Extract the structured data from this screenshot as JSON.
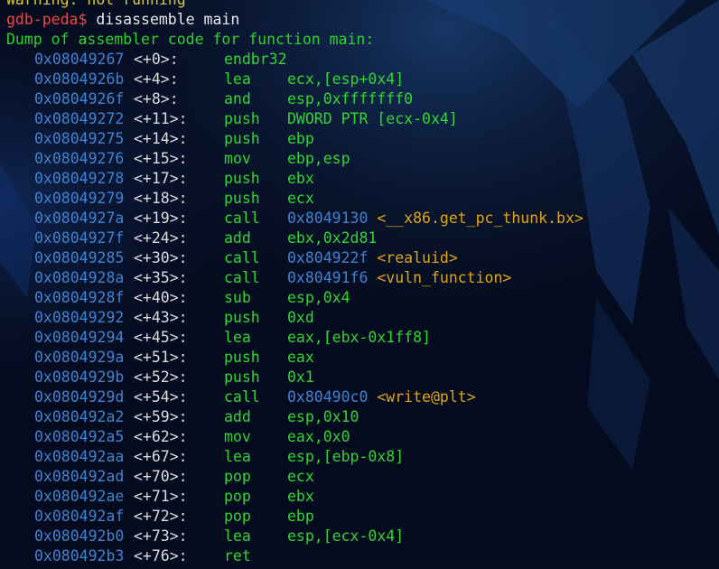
{
  "colors": {
    "background": "#050b1e",
    "warning": "#d7c93a",
    "prompt": "#e84a4a",
    "header": "#2dd32d",
    "address": "#3f84d4",
    "offset": "#dcdcdc",
    "instruction": "#2fd82f",
    "symbol": "#e0a512"
  },
  "warning": "Warning: not running",
  "prompt": "gdb-peda$",
  "command": " disassemble main",
  "header": "Dump of assembler code for function main:",
  "instructions": [
    {
      "address": "0x08049267",
      "offset": "<+0>:",
      "mnemonic": "endbr32",
      "operand": "",
      "symbol": ""
    },
    {
      "address": "0x0804926b",
      "offset": "<+4>:",
      "mnemonic": "lea",
      "operand": "ecx,[esp+0x4]",
      "symbol": ""
    },
    {
      "address": "0x0804926f",
      "offset": "<+8>:",
      "mnemonic": "and",
      "operand": "esp,0xfffffff0",
      "symbol": ""
    },
    {
      "address": "0x08049272",
      "offset": "<+11>:",
      "mnemonic": "push",
      "operand": "DWORD PTR [ecx-0x4]",
      "symbol": ""
    },
    {
      "address": "0x08049275",
      "offset": "<+14>:",
      "mnemonic": "push",
      "operand": "ebp",
      "symbol": ""
    },
    {
      "address": "0x08049276",
      "offset": "<+15>:",
      "mnemonic": "mov",
      "operand": "ebp,esp",
      "symbol": ""
    },
    {
      "address": "0x08049278",
      "offset": "<+17>:",
      "mnemonic": "push",
      "operand": "ebx",
      "symbol": ""
    },
    {
      "address": "0x08049279",
      "offset": "<+18>:",
      "mnemonic": "push",
      "operand": "ecx",
      "symbol": ""
    },
    {
      "address": "0x0804927a",
      "offset": "<+19>:",
      "mnemonic": "call",
      "operand": "0x8049130",
      "symbol": "<__x86.get_pc_thunk.bx>"
    },
    {
      "address": "0x0804927f",
      "offset": "<+24>:",
      "mnemonic": "add",
      "operand": "ebx,0x2d81",
      "symbol": ""
    },
    {
      "address": "0x08049285",
      "offset": "<+30>:",
      "mnemonic": "call",
      "operand": "0x804922f",
      "symbol": "<realuid>"
    },
    {
      "address": "0x0804928a",
      "offset": "<+35>:",
      "mnemonic": "call",
      "operand": "0x80491f6",
      "symbol": "<vuln_function>"
    },
    {
      "address": "0x0804928f",
      "offset": "<+40>:",
      "mnemonic": "sub",
      "operand": "esp,0x4",
      "symbol": ""
    },
    {
      "address": "0x08049292",
      "offset": "<+43>:",
      "mnemonic": "push",
      "operand": "0xd",
      "symbol": ""
    },
    {
      "address": "0x08049294",
      "offset": "<+45>:",
      "mnemonic": "lea",
      "operand": "eax,[ebx-0x1ff8]",
      "symbol": ""
    },
    {
      "address": "0x0804929a",
      "offset": "<+51>:",
      "mnemonic": "push",
      "operand": "eax",
      "symbol": ""
    },
    {
      "address": "0x0804929b",
      "offset": "<+52>:",
      "mnemonic": "push",
      "operand": "0x1",
      "symbol": ""
    },
    {
      "address": "0x0804929d",
      "offset": "<+54>:",
      "mnemonic": "call",
      "operand": "0x80490c0",
      "symbol": "<write@plt>"
    },
    {
      "address": "0x080492a2",
      "offset": "<+59>:",
      "mnemonic": "add",
      "operand": "esp,0x10",
      "symbol": ""
    },
    {
      "address": "0x080492a5",
      "offset": "<+62>:",
      "mnemonic": "mov",
      "operand": "eax,0x0",
      "symbol": ""
    },
    {
      "address": "0x080492aa",
      "offset": "<+67>:",
      "mnemonic": "lea",
      "operand": "esp,[ebp-0x8]",
      "symbol": ""
    },
    {
      "address": "0x080492ad",
      "offset": "<+70>:",
      "mnemonic": "pop",
      "operand": "ecx",
      "symbol": ""
    },
    {
      "address": "0x080492ae",
      "offset": "<+71>:",
      "mnemonic": "pop",
      "operand": "ebx",
      "symbol": ""
    },
    {
      "address": "0x080492af",
      "offset": "<+72>:",
      "mnemonic": "pop",
      "operand": "ebp",
      "symbol": ""
    },
    {
      "address": "0x080492b0",
      "offset": "<+73>:",
      "mnemonic": "lea",
      "operand": "esp,[ecx-0x4]",
      "symbol": ""
    },
    {
      "address": "0x080492b3",
      "offset": "<+76>:",
      "mnemonic": "ret",
      "operand": "",
      "symbol": ""
    }
  ]
}
